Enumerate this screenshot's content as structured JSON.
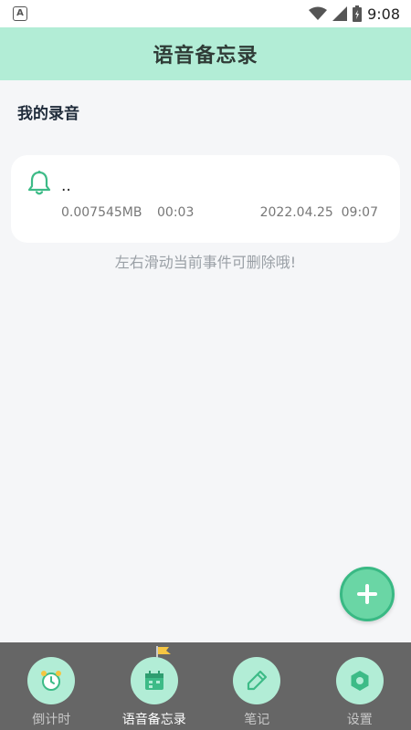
{
  "status_bar": {
    "time": "9:08",
    "left_icon_glyph": "A",
    "icons": [
      "app-a-icon",
      "wifi-icon",
      "signal-icon",
      "battery-icon"
    ]
  },
  "header": {
    "title": "语音备忘录"
  },
  "section": {
    "title": "我的录音"
  },
  "recordings": [
    {
      "name": "..",
      "size": "0.007545MB",
      "duration": "00:03",
      "datetime": "2022.04.25  09:07",
      "icon": "bell-icon"
    }
  ],
  "hint": "左右滑动当前事件可删除哦!",
  "fab": {
    "icon": "plus-icon"
  },
  "nav": {
    "items": [
      {
        "label": "倒计时",
        "icon": "alarm-clock-icon",
        "active": false
      },
      {
        "label": "语音备忘录",
        "icon": "calendar-icon",
        "active": true
      },
      {
        "label": "笔记",
        "icon": "pen-icon",
        "active": false
      },
      {
        "label": "设置",
        "icon": "settings-icon",
        "active": false
      }
    ]
  },
  "colors": {
    "accent": "#b2edd6",
    "fab": "#6ad6a5",
    "nav_bg": "#666666"
  }
}
